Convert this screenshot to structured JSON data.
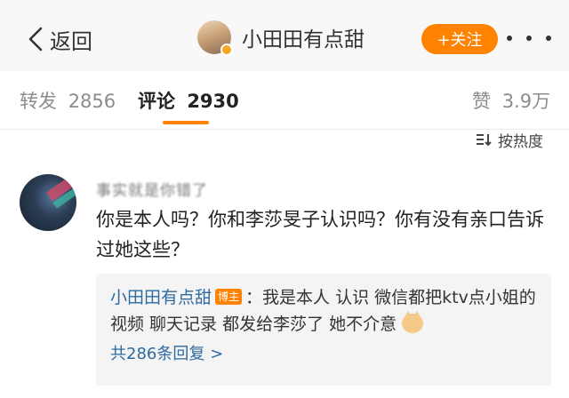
{
  "header": {
    "back_label": "返回",
    "username": "小田田有点甜",
    "follow_label": "+关注"
  },
  "tabs": {
    "repost": {
      "label": "转发",
      "count": "2856"
    },
    "comment": {
      "label": "评论",
      "count": "2930"
    },
    "like": {
      "label": "赞",
      "count": "3.9万"
    }
  },
  "sort": {
    "label": "按热度"
  },
  "comment": {
    "author_name": "事实就是你错了",
    "text": "你是本人吗？你和李莎旻子认识吗？你有没有亲口告诉过她这些？"
  },
  "reply": {
    "author": "小田田有点甜",
    "author_tag": "博主",
    "text": "：我是本人 认识 微信都把ktv点小姐的视频 聊天记录 都发给李莎了 她不介意",
    "emoji": "cat-emoji",
    "more_label": "共286条回复 >"
  },
  "colors": {
    "accent": "#ff8200",
    "link": "#2e6a9e",
    "header_bg": "#f8f8f8",
    "reply_bg": "#f4f4f4"
  }
}
